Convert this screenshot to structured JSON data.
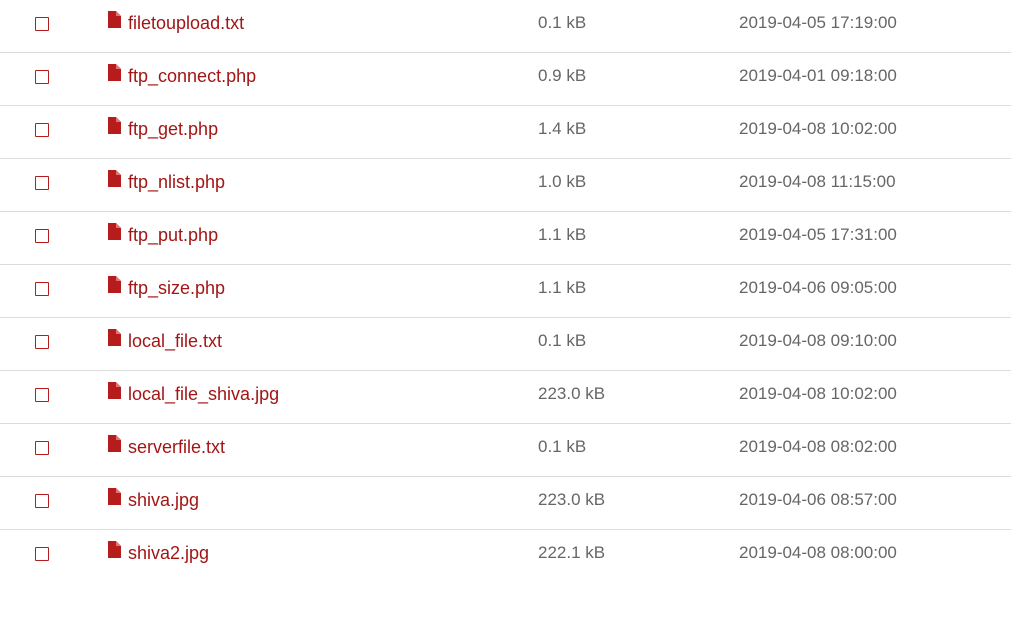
{
  "colors": {
    "accent": "#a31515",
    "icon": "#b71c1c",
    "meta_text": "#666666",
    "divider": "#dcdcdc"
  },
  "files": [
    {
      "name": "filetoupload.txt",
      "size": "0.1 kB",
      "modified": "2019-04-05 17:19:00",
      "icon": "file-icon"
    },
    {
      "name": "ftp_connect.php",
      "size": "0.9 kB",
      "modified": "2019-04-01 09:18:00",
      "icon": "file-icon"
    },
    {
      "name": "ftp_get.php",
      "size": "1.4 kB",
      "modified": "2019-04-08 10:02:00",
      "icon": "file-icon"
    },
    {
      "name": "ftp_nlist.php",
      "size": "1.0 kB",
      "modified": "2019-04-08 11:15:00",
      "icon": "file-icon"
    },
    {
      "name": "ftp_put.php",
      "size": "1.1 kB",
      "modified": "2019-04-05 17:31:00",
      "icon": "file-icon"
    },
    {
      "name": "ftp_size.php",
      "size": "1.1 kB",
      "modified": "2019-04-06 09:05:00",
      "icon": "file-icon"
    },
    {
      "name": "local_file.txt",
      "size": "0.1 kB",
      "modified": "2019-04-08 09:10:00",
      "icon": "file-icon"
    },
    {
      "name": "local_file_shiva.jpg",
      "size": "223.0 kB",
      "modified": "2019-04-08 10:02:00",
      "icon": "file-icon"
    },
    {
      "name": "serverfile.txt",
      "size": "0.1 kB",
      "modified": "2019-04-08 08:02:00",
      "icon": "file-icon"
    },
    {
      "name": "shiva.jpg",
      "size": "223.0 kB",
      "modified": "2019-04-06 08:57:00",
      "icon": "file-icon"
    },
    {
      "name": "shiva2.jpg",
      "size": "222.1 kB",
      "modified": "2019-04-08 08:00:00",
      "icon": "file-icon"
    }
  ]
}
